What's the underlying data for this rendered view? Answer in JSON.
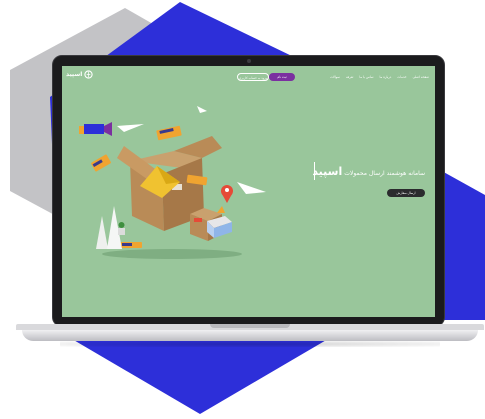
{
  "colors": {
    "screen_bg": "#99c69b",
    "hex_blue": "#2d2fd9",
    "hex_gray": "#c3c3c6",
    "signup_bg": "#7b2fa0",
    "cta_bg": "#2b2b2e"
  },
  "header": {
    "logo_text": "اسپید",
    "logo_icon": "leaf-pin-icon",
    "nav_items": [
      "صفحه اصلی",
      "خدمات",
      "درباره ما",
      "تماس با ما",
      "تعرفه",
      "سوالات"
    ],
    "signup_label": "ثبت نام",
    "login_label": "ورود به حساب کاربری"
  },
  "hero": {
    "brand_word": "اسپید",
    "slogan": "سامانه هوشمند ارسال محمولات",
    "cta_label": "ارسال سفارش"
  },
  "illustration": {
    "description_icons": [
      "parcel-box-icon",
      "paper-plane-icon",
      "location-pin-icon",
      "envelope-icon",
      "plant-pot-icon",
      "traffic-cone-icon"
    ]
  }
}
